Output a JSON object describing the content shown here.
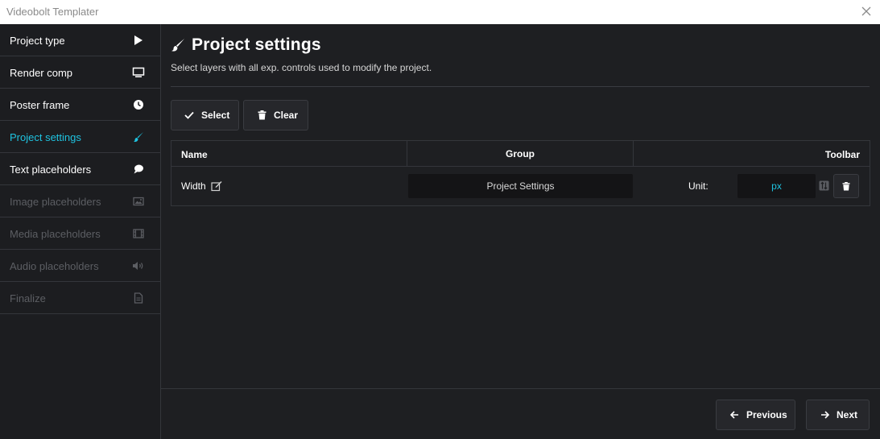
{
  "window": {
    "title": "Videobolt Templater",
    "close_icon": "close-icon"
  },
  "sidebar": {
    "items": [
      {
        "label": "Project type",
        "icon": "play-icon",
        "state": "normal"
      },
      {
        "label": "Render comp",
        "icon": "monitor-icon",
        "state": "normal"
      },
      {
        "label": "Poster frame",
        "icon": "clock-icon",
        "state": "normal"
      },
      {
        "label": "Project settings",
        "icon": "brush-icon",
        "state": "active"
      },
      {
        "label": "Text placeholders",
        "icon": "speech-bubble-icon",
        "state": "normal"
      },
      {
        "label": "Image placeholders",
        "icon": "image-icon",
        "state": "disabled"
      },
      {
        "label": "Media placeholders",
        "icon": "film-icon",
        "state": "disabled"
      },
      {
        "label": "Audio placeholders",
        "icon": "speaker-icon",
        "state": "disabled"
      },
      {
        "label": "Finalize",
        "icon": "document-icon",
        "state": "disabled"
      }
    ]
  },
  "header": {
    "title": "Project settings",
    "subtitle": "Select layers with all exp. controls used to modify the project."
  },
  "toolbar": {
    "select_label": "Select",
    "clear_label": "Clear"
  },
  "table": {
    "columns": [
      "Name",
      "Group",
      "Toolbar"
    ],
    "rows": [
      {
        "name": "Width",
        "group": "Project Settings",
        "unit_label": "Unit:",
        "unit_value": "px"
      }
    ]
  },
  "footer": {
    "previous_label": "Previous",
    "next_label": "Next"
  },
  "colors": {
    "accent": "#1fc3e0",
    "background": "#1e1f22",
    "sidebar": "#1c1d20",
    "disabled_text": "#5c5e63"
  }
}
